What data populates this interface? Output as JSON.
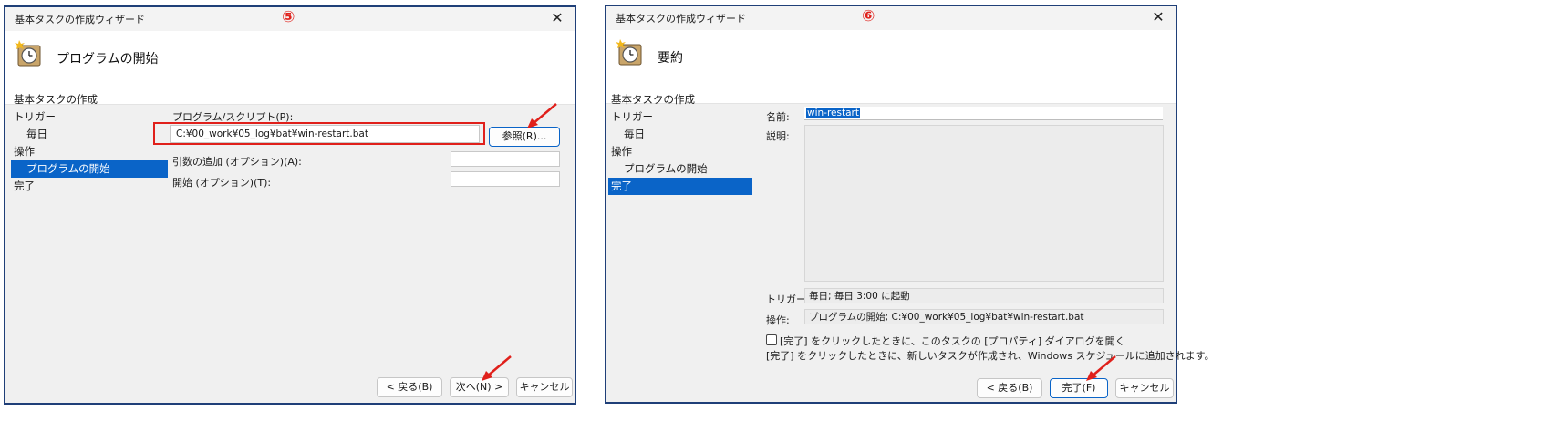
{
  "left": {
    "title": "基本タスクの作成ウィザード",
    "marker": "⑤",
    "close": "✕",
    "header_title": "プログラムの開始",
    "nav": [
      "基本タスクの作成",
      "トリガー",
      "毎日",
      "操作",
      "プログラムの開始",
      "完了"
    ],
    "program_label": "プログラム/スクリプト(P):",
    "program_value": "C:¥00_work¥05_log¥bat¥win-restart.bat",
    "browse_button": "参照(R)...",
    "args_label": "引数の追加 (オプション)(A):",
    "start_label": "開始 (オプション)(T):",
    "back_button": "< 戻る(B)",
    "next_button": "次へ(N) >",
    "cancel_button": "キャンセル"
  },
  "right": {
    "title": "基本タスクの作成ウィザード",
    "marker": "⑥",
    "close": "✕",
    "header_title": "要約",
    "nav": [
      "基本タスクの作成",
      "トリガー",
      "毎日",
      "操作",
      "プログラムの開始",
      "完了"
    ],
    "name_label": "名前:",
    "name_value": "win-restart",
    "desc_label": "説明:",
    "trigger_label": "トリガー:",
    "trigger_value": "毎日; 毎日 3:00 に起動",
    "action_label": "操作:",
    "action_value": "プログラムの開始; C:¥00_work¥05_log¥bat¥win-restart.bat",
    "open_props_checkbox": "[完了] をクリックしたときに、このタスクの [プロパティ] ダイアログを開く",
    "finish_note": "[完了] をクリックしたときに、新しいタスクが作成され、Windows スケジュールに追加されます。",
    "back_button": "< 戻る(B)",
    "finish_button": "完了(F)",
    "cancel_button": "キャンセル"
  }
}
